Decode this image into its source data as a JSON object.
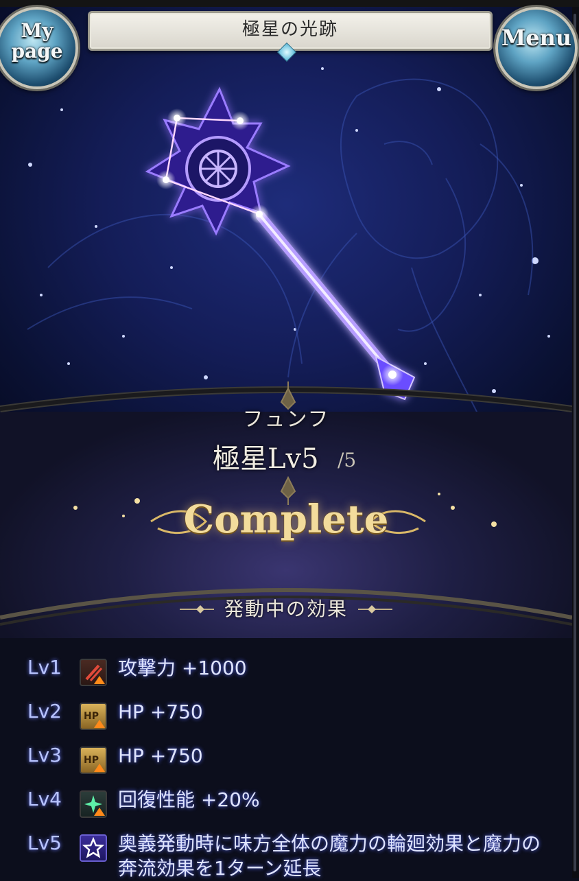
{
  "header": {
    "title": "極星の光跡",
    "mypage_line1": "My",
    "mypage_line2": "page",
    "menu_label": "Menu"
  },
  "constellation": {
    "name": "フュンフ",
    "level_label": "極星Lv",
    "level": "5",
    "level_max": "/5",
    "status": "Complete",
    "section_title": "発動中の効果"
  },
  "effects": [
    {
      "lv": "Lv1",
      "icon": "attack-up-icon",
      "text": "攻撃力 +1000"
    },
    {
      "lv": "Lv2",
      "icon": "hp-up-icon",
      "icon_text": "HP",
      "text": "HP +750"
    },
    {
      "lv": "Lv3",
      "icon": "hp-up-icon",
      "icon_text": "HP",
      "text": "HP +750"
    },
    {
      "lv": "Lv4",
      "icon": "heal-up-icon",
      "text": "回復性能 +20%"
    },
    {
      "lv": "Lv5",
      "icon": "star-icon",
      "text": "奥義発動時に味方全体の魔力の輪廻効果と魔力の奔流効果を1ターン延長"
    }
  ],
  "colors": {
    "background": "#0c0e1c",
    "sky": "#141d58",
    "glow": "#8a5cff",
    "gold": "#f3dc9c",
    "effect_text": "#dfe4ff"
  }
}
